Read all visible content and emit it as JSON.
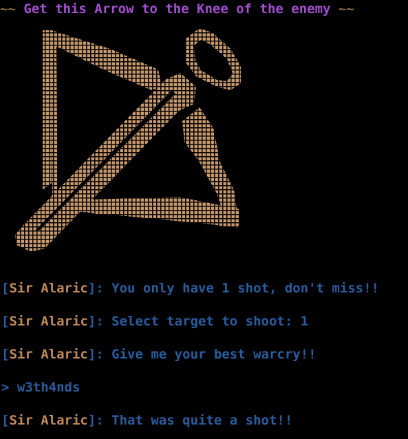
{
  "banner": {
    "left_tilde": "~~",
    "title": "Get this Arrow to the Knee of the enemy",
    "right_tilde": "~~"
  },
  "art": {
    "subject": "crossbow-icon",
    "color": "#c99a6e"
  },
  "colors": {
    "background": "#000000",
    "banner_title": "#a34fd0",
    "banner_tilde": "#8d6d3c",
    "speaker": "#c08a5a",
    "message": "#2a5d9f"
  },
  "log": [
    {
      "bracket_open": "[",
      "speaker": "Sir Alaric",
      "bracket_close": "]:",
      "text": " You only have 1 shot, don't miss!!"
    },
    {
      "bracket_open": "[",
      "speaker": "Sir Alaric",
      "bracket_close": "]:",
      "text": " Select target to shoot: 1"
    },
    {
      "bracket_open": "[",
      "speaker": "Sir Alaric",
      "bracket_close": "]:",
      "text": " Give me your best warcry!!"
    },
    {
      "prompt": ">",
      "input": " w3th4nds"
    },
    {
      "bracket_open": "[",
      "speaker": "Sir Alaric",
      "bracket_close": "]:",
      "text": " That was quite a shot!!"
    }
  ]
}
